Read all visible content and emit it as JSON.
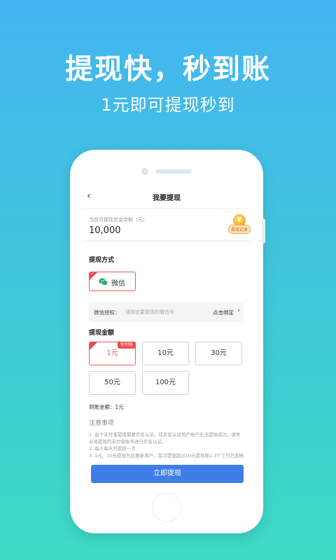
{
  "promo": {
    "headline": "提现快，秒到账",
    "subline": "1元即可提现秒到"
  },
  "nav": {
    "back_icon": "‹",
    "title": "我要提现"
  },
  "balance": {
    "label": "当前可提现赏金余额（元）",
    "amount": "10,000",
    "record_label": "提现记录",
    "coin_glyph": "¥"
  },
  "method": {
    "section_title": "提现方式",
    "option_label": "微信",
    "wechat_color": "#2aae67"
  },
  "auth": {
    "label": "微信授权：",
    "placeholder": "请绑定要提现的微信号",
    "bind_label": "点击绑定",
    "chevron": "›"
  },
  "amount": {
    "section_title": "提现金额",
    "options": [
      {
        "label": "1元",
        "badge": "秒到账",
        "selected": true
      },
      {
        "label": "10元"
      },
      {
        "label": "30元"
      },
      {
        "label": "50元"
      },
      {
        "label": "100元"
      }
    ]
  },
  "arrival": {
    "text": "到账金额：1元"
  },
  "notes": {
    "title": "注意事项",
    "items": [
      "1. 由于支付宝提现需要实名认证，非实名认证用户账户无法提现成功，请务必将提现的支付宝账号进行实名认证。",
      "2. 每人每天可提现一次",
      "3. 1元、10元提现为优惠新用户，首次提现超过10元提现周1-3个工作日到账"
    ]
  },
  "submit": {
    "label": "立即提现"
  },
  "colors": {
    "accent": "#3f7de8",
    "selected": "#e85a5a"
  }
}
